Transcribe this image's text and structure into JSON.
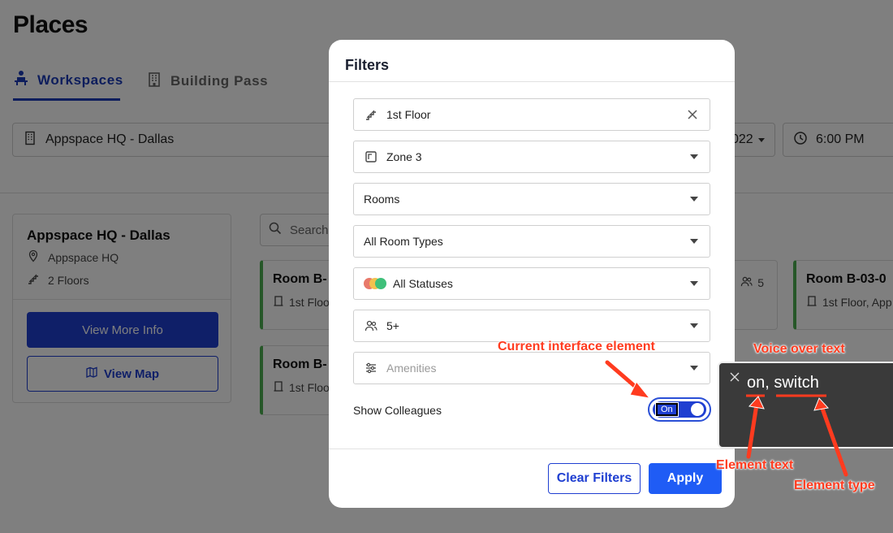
{
  "page": {
    "title": "Places",
    "tabs": [
      {
        "label": "Workspaces",
        "active": true
      },
      {
        "label": "Building Pass",
        "active": false
      }
    ],
    "building_select": "Appspace HQ - Dallas",
    "date_fragment": "022",
    "time_select": "6:00 PM",
    "building_card": {
      "title": "Appspace HQ - Dallas",
      "location": "Appspace HQ",
      "floors": "2 Floors",
      "view_more": "View More Info",
      "view_map": "View Map"
    },
    "search_placeholder": "Search w",
    "room_cards": [
      {
        "title": "Room B-",
        "sub": "1st Floo"
      },
      {
        "title": "Room B-",
        "sub": "1st Floo"
      },
      {
        "title": "Room B-03-0",
        "sub": "1st Floor, App"
      }
    ],
    "capacity_fragment": "5"
  },
  "filters": {
    "title": "Filters",
    "floor": "1st Floor",
    "zone": "Zone 3",
    "space_type": "Rooms",
    "room_types": "All Room Types",
    "statuses": "All Statuses",
    "capacity": "5+",
    "amenities_placeholder": "Amenities",
    "show_colleagues_label": "Show Colleagues",
    "toggle_text": "On",
    "clear_button": "Clear Filters",
    "apply_button": "Apply"
  },
  "voiceover": {
    "text": "on, switch"
  },
  "annotations": {
    "current_element": "Current interface element",
    "voice_over": "Voice over text",
    "element_text": "Element text",
    "element_type": "Element type"
  },
  "colors": {
    "brand_blue": "#1f3fd1",
    "apply_blue": "#1f5cf5",
    "status_green": "#4caf50",
    "annotation_red": "#ff3b1f"
  }
}
